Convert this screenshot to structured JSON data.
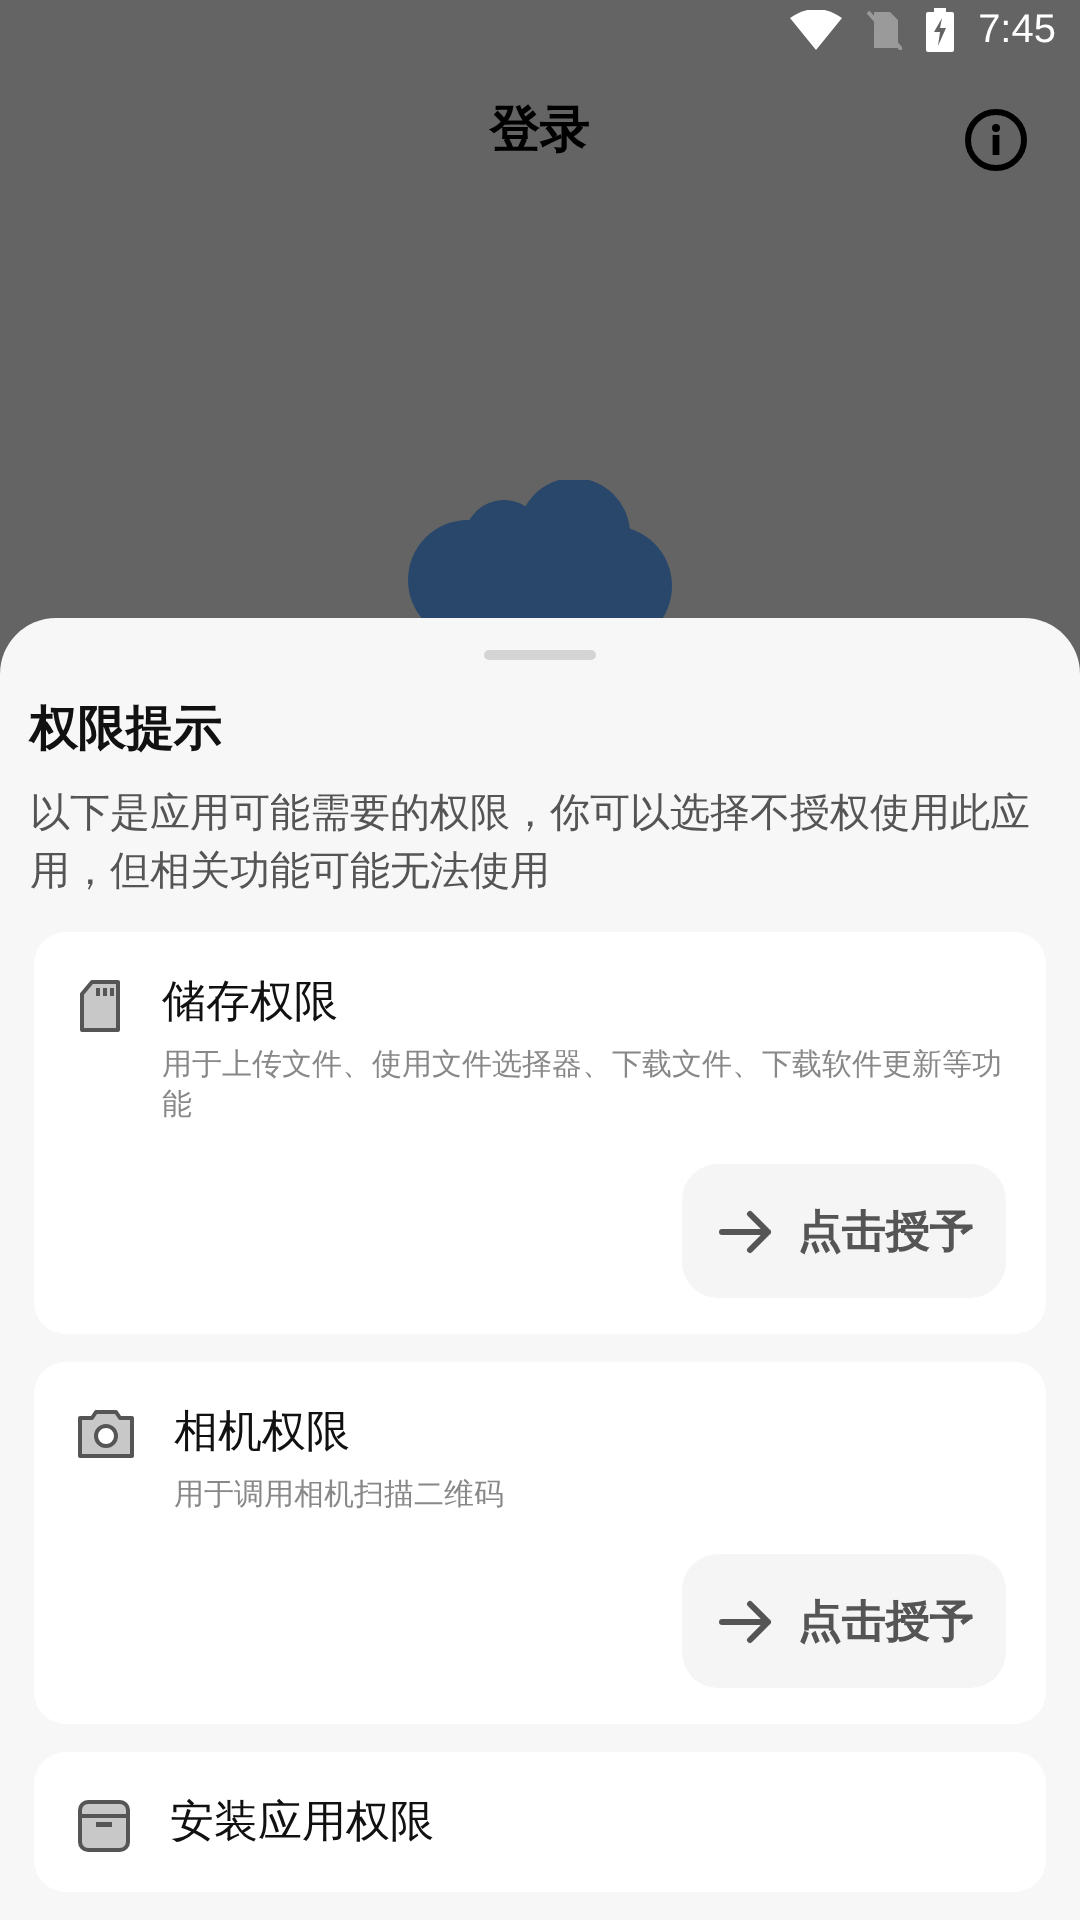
{
  "status_bar": {
    "time": "7:45"
  },
  "app_bar": {
    "title": "登录"
  },
  "sheet": {
    "title": "权限提示",
    "description": "以下是应用可能需要的权限，你可以选择不授权使用此应用，但相关功能可能无法使用",
    "permissions": [
      {
        "kind": "storage",
        "title": "储存权限",
        "description": "用于上传文件、使用文件选择器、下载文件、下载软件更新等功能",
        "button": "点击授予"
      },
      {
        "kind": "camera",
        "title": "相机权限",
        "description": "用于调用相机扫描二维码",
        "button": "点击授予"
      },
      {
        "kind": "install",
        "title": "安装应用权限"
      }
    ]
  }
}
